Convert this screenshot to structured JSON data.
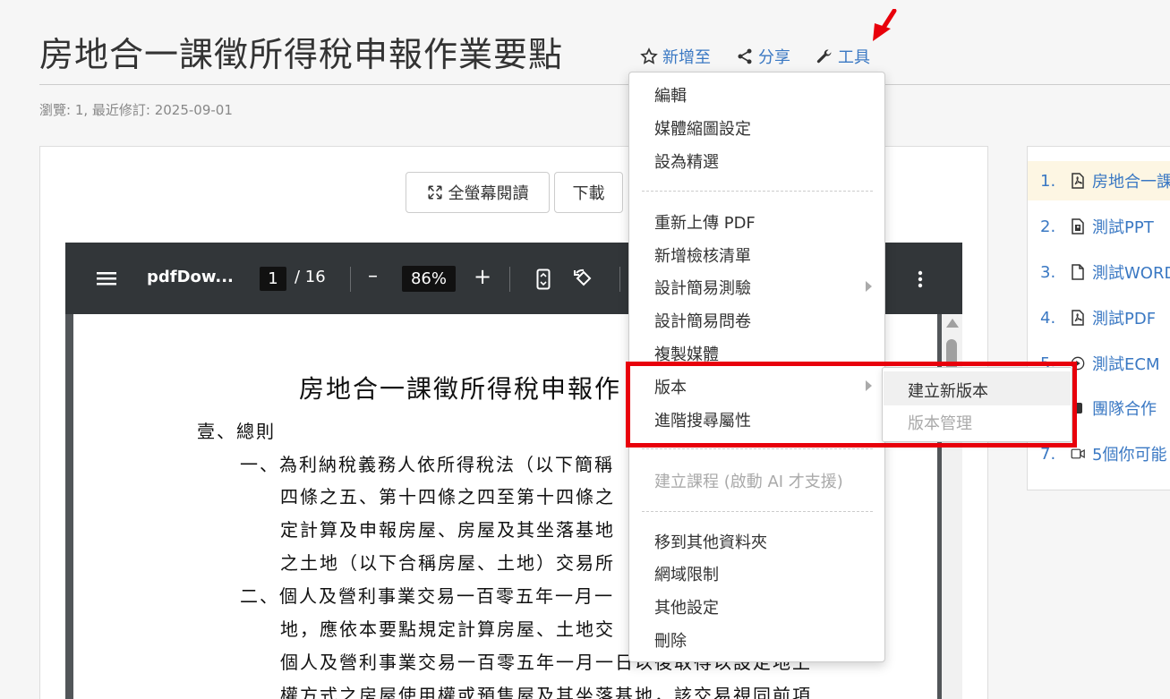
{
  "page": {
    "title": "房地合一課徵所得稅申報作業要點",
    "meta": "瀏覽: 1, 最近修訂: 2025-09-01"
  },
  "header_actions": [
    {
      "icon": "star-outline-icon",
      "label": "新增至"
    },
    {
      "icon": "share-icon",
      "label": "分享"
    },
    {
      "icon": "wrench-icon",
      "label": "工具"
    }
  ],
  "doc_buttons": {
    "fullscreen": "全螢幕閱讀",
    "download": "下載"
  },
  "pdf_toolbar": {
    "filename": "pdfDow...",
    "page_current": "1",
    "page_total": "/ 16",
    "zoom": "86%",
    "minus": "–",
    "plus": "+"
  },
  "pdf_content": {
    "title": "房地合一課徵所得稅申報作",
    "lines": [
      "壹、總則",
      "一、為利納稅義務人依所得稅法（以下簡稱",
      "四條之五、第十四條之四至第十四條之",
      "定計算及申報房屋、房屋及其坐落基地",
      "之土地（以下合稱房屋、土地）交易所",
      "二、個人及營利事業交易一百零五年一月一",
      "地，應依本要點規定計算房屋、土地交",
      "個人及營利事業交易一百零五年一月一日以後取得以設定地上",
      "權方式之房屋使用權或預售屋及其坐落基地，該交易視同前項"
    ]
  },
  "tools_menu": {
    "group1": [
      "編輯",
      "媒體縮圖設定",
      "設為精選"
    ],
    "group2": [
      "重新上傳 PDF",
      "新增檢核清單",
      "設計簡易測驗",
      "設計簡易問卷",
      "複製媒體",
      "版本",
      "進階搜尋屬性"
    ],
    "group3": [
      "建立課程 (啟動 AI 才支援)"
    ],
    "group4": [
      "移到其他資料夾",
      "網域限制",
      "其他設定",
      "刪除"
    ]
  },
  "version_submenu": [
    "建立新版本",
    "版本管理"
  ],
  "sidebar": {
    "items": [
      {
        "num": "1.",
        "icon": "pdf-file-icon",
        "label": "房地合一課"
      },
      {
        "num": "2.",
        "icon": "ppt-file-icon",
        "label": "測試PPT"
      },
      {
        "num": "3.",
        "icon": "file-icon",
        "label": "測試WORD"
      },
      {
        "num": "4.",
        "icon": "pdf-file-icon",
        "label": "測試PDF"
      },
      {
        "num": "5.",
        "icon": "play-circle-icon",
        "label": "測試ECM"
      },
      {
        "num": "6.",
        "icon": "team-icon",
        "label": "團隊合作"
      },
      {
        "num": "7.",
        "icon": "video-icon",
        "label": "5個你可能"
      }
    ]
  },
  "colors": {
    "link": "#3a78c3",
    "highlight": "#e8000b",
    "viewer_toolbar": "#323639"
  }
}
